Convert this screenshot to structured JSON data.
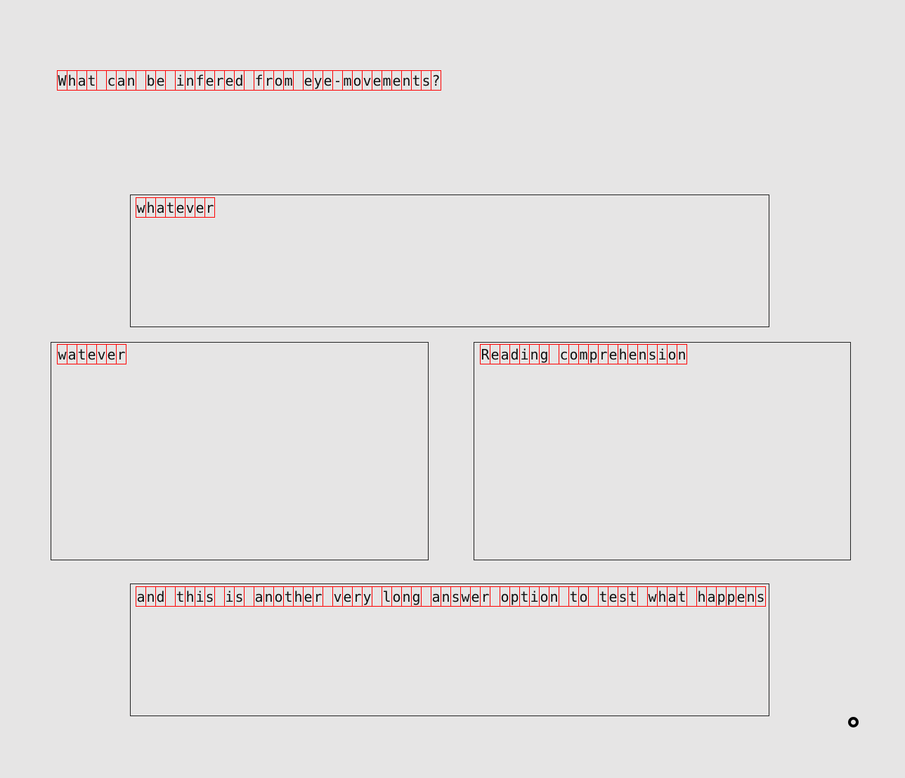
{
  "question": "What can be infered from eye-movements?",
  "options": [
    "whatever",
    "watever",
    "Reading comprehension",
    "and this is another very long answer option to test what happens"
  ],
  "marker_icon": "fixation-target-icon"
}
